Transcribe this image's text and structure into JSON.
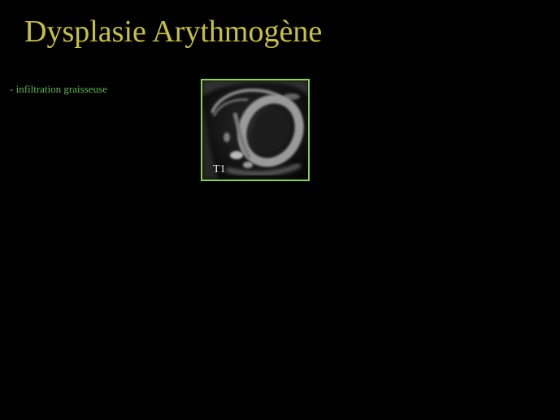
{
  "slide": {
    "title": "Dysplasie Arythmogène",
    "bullet": "- infiltration graisseuse",
    "image": {
      "label": "T1",
      "sequence": "T1"
    }
  },
  "colors": {
    "background": "#000000",
    "title": "#c8c23a",
    "bullet": "#5fb84a",
    "image_border": "#8ad24f",
    "image_label": "#e8e8e8"
  }
}
